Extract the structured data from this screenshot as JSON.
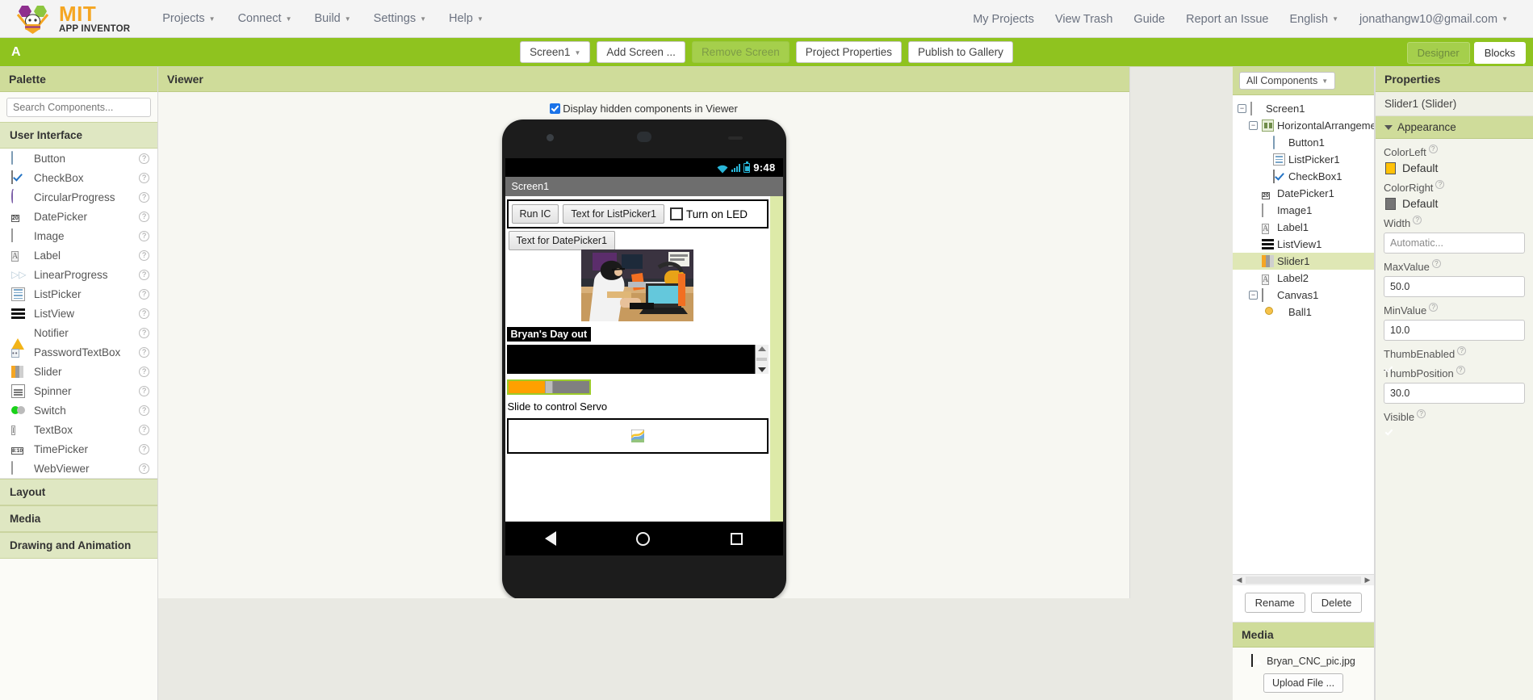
{
  "brand": {
    "title_main": "MIT",
    "title_sub": "APP INVENTOR",
    "logo_icon": "mit-app-inventor-bee-logo"
  },
  "topnav": {
    "left_items": [
      {
        "label": "Projects",
        "has_caret": true
      },
      {
        "label": "Connect",
        "has_caret": true
      },
      {
        "label": "Build",
        "has_caret": true
      },
      {
        "label": "Settings",
        "has_caret": true
      },
      {
        "label": "Help",
        "has_caret": true
      }
    ],
    "right_items": [
      {
        "label": "My Projects",
        "has_caret": false
      },
      {
        "label": "View Trash",
        "has_caret": false
      },
      {
        "label": "Guide",
        "has_caret": false
      },
      {
        "label": "Report an Issue",
        "has_caret": false
      },
      {
        "label": "English",
        "has_caret": true
      },
      {
        "label": "jonathangw10@gmail.com",
        "has_caret": true
      }
    ]
  },
  "toolbar": {
    "project_name": "A",
    "screen_selector": "Screen1",
    "add_screen": "Add Screen ...",
    "remove_screen": "Remove Screen",
    "project_properties": "Project Properties",
    "publish_gallery": "Publish to Gallery",
    "designer_tab": "Designer",
    "blocks_tab": "Blocks",
    "accent_green": "#8fc31f"
  },
  "palette": {
    "header": "Palette",
    "search_placeholder": "Search Components...",
    "search_value": "",
    "sections": [
      {
        "name": "User Interface",
        "expanded": true,
        "items": [
          {
            "label": "Button",
            "icon": "button-icon"
          },
          {
            "label": "CheckBox",
            "icon": "checkbox-icon"
          },
          {
            "label": "CircularProgress",
            "icon": "circular-progress-icon"
          },
          {
            "label": "DatePicker",
            "icon": "datepicker-icon"
          },
          {
            "label": "Image",
            "icon": "image-icon"
          },
          {
            "label": "Label",
            "icon": "label-icon"
          },
          {
            "label": "LinearProgress",
            "icon": "linear-progress-icon"
          },
          {
            "label": "ListPicker",
            "icon": "listpicker-icon"
          },
          {
            "label": "ListView",
            "icon": "listview-icon"
          },
          {
            "label": "Notifier",
            "icon": "notifier-icon"
          },
          {
            "label": "PasswordTextBox",
            "icon": "password-textbox-icon"
          },
          {
            "label": "Slider",
            "icon": "slider-icon"
          },
          {
            "label": "Spinner",
            "icon": "spinner-icon"
          },
          {
            "label": "Switch",
            "icon": "switch-icon"
          },
          {
            "label": "TextBox",
            "icon": "textbox-icon"
          },
          {
            "label": "TimePicker",
            "icon": "timepicker-icon"
          },
          {
            "label": "WebViewer",
            "icon": "webviewer-icon"
          }
        ]
      },
      {
        "name": "Layout",
        "expanded": false,
        "items": []
      },
      {
        "name": "Media",
        "expanded": false,
        "items": []
      },
      {
        "name": "Drawing and Animation",
        "expanded": false,
        "items": []
      }
    ],
    "help_glyph": "?"
  },
  "viewer": {
    "header": "Viewer",
    "hidden_components_label": "Display hidden components in Viewer",
    "hidden_components_checked": true,
    "phone": {
      "status_time": "9:48",
      "title_bar": "Screen1",
      "components": {
        "button1_text": "Run IC",
        "listpicker1_text": "Text for ListPicker1",
        "checkbox1_text": "Turn on LED",
        "checkbox1_checked": false,
        "datepicker1_text": "Text for DatePicker1",
        "image1_alt": "Bryan_CNC_pic.jpg",
        "label1_text": "Bryan's Day out",
        "label2_text": "Slide to control Servo",
        "slider1_selected": true,
        "slider1_thumb_fraction": 0.45
      },
      "navbar": {
        "back": "back-icon",
        "home": "home-icon",
        "recents": "recents-icon"
      }
    }
  },
  "components_panel": {
    "filter_label": "All Components",
    "tree": [
      {
        "label": "Screen1",
        "icon": "screen-icon",
        "depth": 0,
        "expander": "−",
        "selected": false
      },
      {
        "label": "HorizontalArrangement1",
        "icon": "horizontal-arrangement-icon",
        "depth": 1,
        "expander": "−",
        "selected": false
      },
      {
        "label": "Button1",
        "icon": "button-icon",
        "depth": 2,
        "expander": "",
        "selected": false
      },
      {
        "label": "ListPicker1",
        "icon": "listpicker-icon",
        "depth": 2,
        "expander": "",
        "selected": false
      },
      {
        "label": "CheckBox1",
        "icon": "checkbox-icon",
        "depth": 2,
        "expander": "",
        "selected": false
      },
      {
        "label": "DatePicker1",
        "icon": "datepicker-icon",
        "depth": 1,
        "expander": "",
        "selected": false
      },
      {
        "label": "Image1",
        "icon": "image-icon",
        "depth": 1,
        "expander": "",
        "selected": false
      },
      {
        "label": "Label1",
        "icon": "label-icon",
        "depth": 1,
        "expander": "",
        "selected": false
      },
      {
        "label": "ListView1",
        "icon": "listview-icon",
        "depth": 1,
        "expander": "",
        "selected": false
      },
      {
        "label": "Slider1",
        "icon": "slider-icon",
        "depth": 1,
        "expander": "",
        "selected": true
      },
      {
        "label": "Label2",
        "icon": "label-icon",
        "depth": 1,
        "expander": "",
        "selected": false
      },
      {
        "label": "Canvas1",
        "icon": "canvas-icon",
        "depth": 1,
        "expander": "−",
        "selected": false
      },
      {
        "label": "Ball1",
        "icon": "ball-icon",
        "depth": 2,
        "expander": "",
        "selected": false
      }
    ],
    "rename_button": "Rename",
    "delete_button": "Delete"
  },
  "media_panel": {
    "header": "Media",
    "files": [
      {
        "name": "Bryan_CNC_pic.jpg",
        "icon": "image-file-icon"
      }
    ],
    "upload_button": "Upload File ..."
  },
  "properties": {
    "header": "Properties",
    "component": "Slider1 (Slider)",
    "group": "Appearance",
    "group_expanded": true,
    "fields": [
      {
        "name": "ColorLeft",
        "type": "color",
        "value": "Default",
        "swatch": "#FFC107"
      },
      {
        "name": "ColorRight",
        "type": "color",
        "value": "Default",
        "swatch": "#757575"
      },
      {
        "name": "Width",
        "type": "text",
        "value": "Automatic...",
        "placeholder": true
      },
      {
        "name": "MaxValue",
        "type": "text",
        "value": "50.0",
        "placeholder": false
      },
      {
        "name": "MinValue",
        "type": "text",
        "value": "10.0",
        "placeholder": false
      },
      {
        "name": "ThumbEnabled",
        "type": "checkbox",
        "value": true
      },
      {
        "name": "ThumbPosition",
        "type": "text",
        "value": "30.0",
        "placeholder": false
      },
      {
        "name": "Visible",
        "type": "checkbox",
        "value": true
      }
    ],
    "help_glyph": "?"
  }
}
